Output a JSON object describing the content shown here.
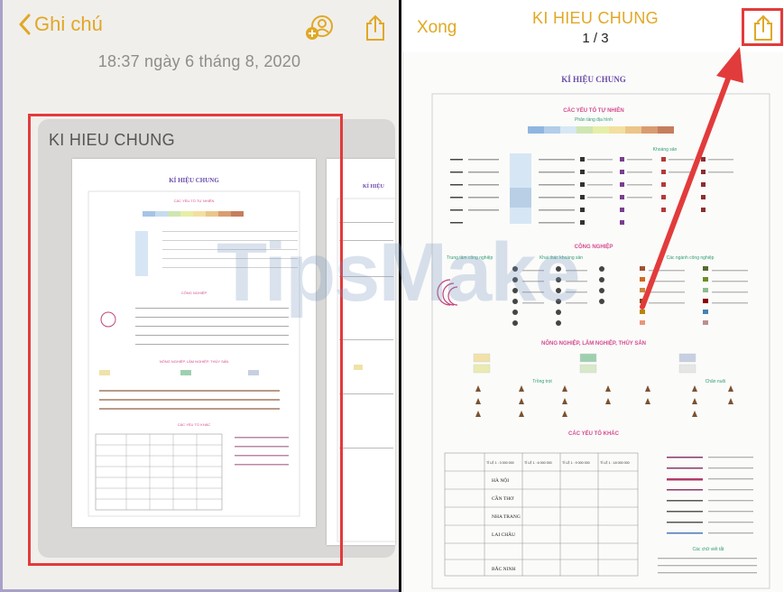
{
  "left": {
    "back_label": "Ghi chú",
    "date": "18:37 ngày 6 tháng 8, 2020",
    "attachment_title": "KI HIEU CHUNG"
  },
  "right": {
    "done_label": "Xong",
    "title": "KI HIEU CHUNG",
    "page_indicator": "1 / 3"
  },
  "document": {
    "title": "KÍ HIỆU CHUNG",
    "natural": "CÁC YẾU TỐ TỰ NHIÊN",
    "elevation": "Phân tầng địa hình",
    "minerals": "Khoáng sản",
    "industry": "CÔNG NGHIỆP",
    "industry_center": "Trung tâm công nghiệp",
    "mining": "Khai thác khoáng sản",
    "industry_branches": "Các ngành công nghiệp",
    "agriculture": "NÔNG NGHIỆP, LÂM NGHIỆP, THỦY SẢN",
    "crops": "Trồng trọt",
    "livestock": "Chăn nuôi",
    "other": "CÁC YẾU TỐ KHÁC",
    "abbrev": "Các chữ viết tắt",
    "cities": [
      "HÀ NỘI",
      "CẦN THƠ",
      "NHA TRANG",
      "LAI CHÂU",
      "BẮC NINH"
    ],
    "scales": [
      "TỈ LỆ 1 : 3 000 000",
      "TỈ LỆ 1 : 6 000 000",
      "TỈ LỆ 1 : 9 000 000",
      "TỈ LỆ 1 : 18 000 000"
    ]
  },
  "watermark": "TipsMake",
  "colors": {
    "accent": "#e1a825",
    "highlight": "#e23b3b",
    "notes_bg": "#f1efec",
    "card_bg": "#d9d8d6"
  },
  "icons": [
    "chevron-left-icon",
    "add-person-icon",
    "share-icon"
  ]
}
